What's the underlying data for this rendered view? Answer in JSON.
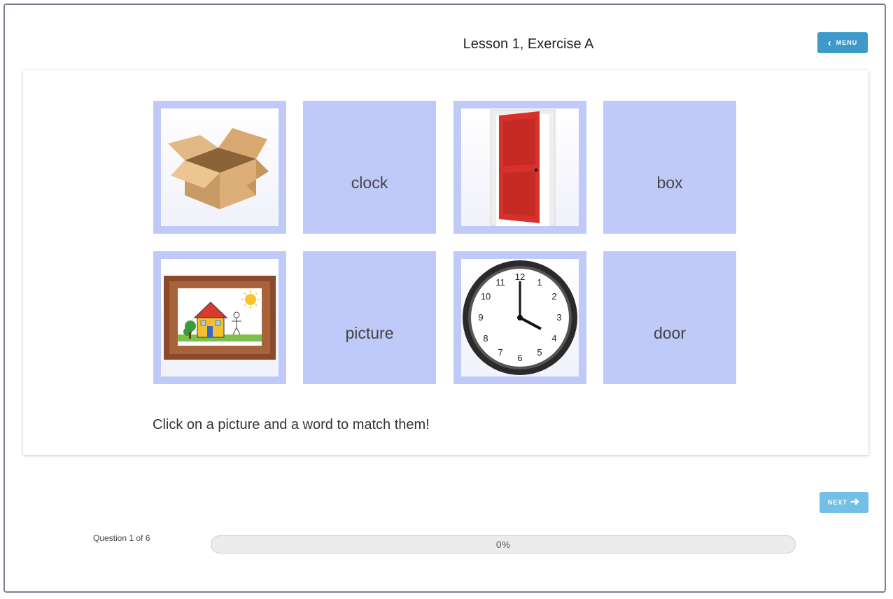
{
  "header": {
    "title": "Lesson 1, Exercise A",
    "menu_label": "MENU"
  },
  "tiles": [
    {
      "kind": "picture",
      "icon": "cardboard-box-picture"
    },
    {
      "kind": "word",
      "label": "clock"
    },
    {
      "kind": "picture",
      "icon": "red-door-picture"
    },
    {
      "kind": "word",
      "label": "box"
    },
    {
      "kind": "picture",
      "icon": "framed-house-drawing-picture"
    },
    {
      "kind": "word",
      "label": "picture"
    },
    {
      "kind": "picture",
      "icon": "wall-clock-picture"
    },
    {
      "kind": "word",
      "label": "door"
    }
  ],
  "instruction": "Click on a picture and a word to match them!",
  "footer": {
    "next_label": "NEXT",
    "question_counter": "Question 1 of 6",
    "progress_percent": 0,
    "progress_label": "0%"
  },
  "colors": {
    "tile_bg": "#bfcaf9",
    "menu_button": "#3f9ac9",
    "next_button": "#74bfe6"
  }
}
